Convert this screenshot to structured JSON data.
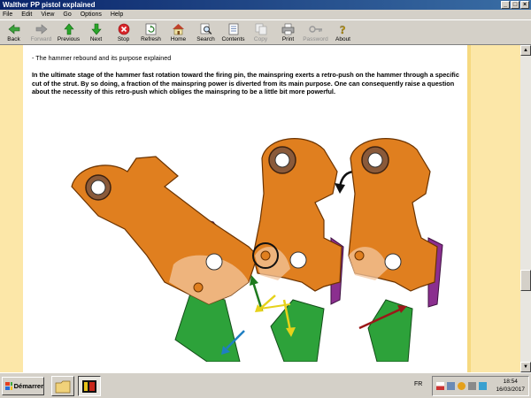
{
  "window": {
    "title": "Walther PP pistol explained"
  },
  "menu": [
    "File",
    "Edit",
    "View",
    "Go",
    "Options",
    "Help"
  ],
  "toolbar": {
    "back": "Back",
    "forward": "Forward",
    "previous": "Previous",
    "next": "Next",
    "stop": "Stop",
    "refresh": "Refresh",
    "home": "Home",
    "search": "Search",
    "contents": "Contents",
    "copy": "Copy",
    "print": "Print",
    "password": "Password",
    "about": "About"
  },
  "content": {
    "heading": "- The hammer rebound and its purpose explained",
    "paragraph": "In the ultimate stage of the hammer fast rotation toward the firing pin, the mainspring exerts a retro-push on the hammer through a specific cut of the strut. By so doing, a fraction of the mainspring power is diverted from its main purpose. One can consequently raise a question about the necessity of this retro-push which obliges the mainspring to be a little bit more powerful."
  },
  "taskbar": {
    "start": "Démarrer",
    "language": "FR",
    "time": "18:54",
    "date": "16/03/2017"
  },
  "colors": {
    "hammer": "#e07f1f",
    "strut": "#2fa03a",
    "sear": "#8b2f8f",
    "sidebar": "#fce7a8"
  }
}
